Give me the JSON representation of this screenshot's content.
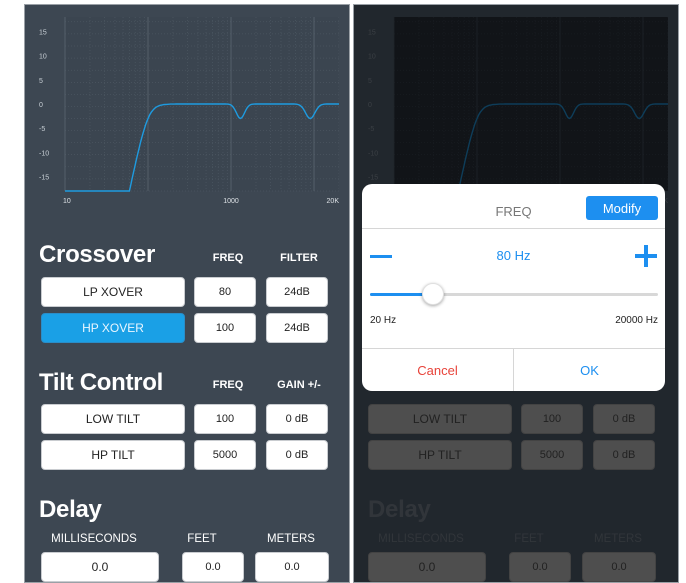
{
  "graph": {
    "y_ticks": [
      "15",
      "10",
      "5",
      "0",
      "-5",
      "-10",
      "-15"
    ],
    "x_ticks": [
      "10",
      "1000",
      "20K"
    ],
    "curve_color": "#1e9be0"
  },
  "crossover": {
    "title": "Crossover",
    "freq_header": "FREQ",
    "filter_header": "FILTER",
    "rows": [
      {
        "label": "LP XOVER",
        "freq": "80",
        "filter": "24dB",
        "active": false
      },
      {
        "label": "HP XOVER",
        "freq": "100",
        "filter": "24dB",
        "active": true
      }
    ]
  },
  "tilt": {
    "title": "Tilt Control",
    "freq_header": "FREQ",
    "gain_header": "GAIN +/-",
    "rows": [
      {
        "label": "LOW TILT",
        "freq": "100",
        "gain": "0 dB"
      },
      {
        "label": "HP TILT",
        "freq": "5000",
        "gain": "0 dB"
      }
    ]
  },
  "delay": {
    "title": "Delay",
    "ms_header": "MILLISECONDS",
    "feet_header": "FEET",
    "meters_header": "METERS",
    "ms_value": "0.0",
    "feet_value": "0.0",
    "meters_value": "0.0"
  },
  "dialog": {
    "title": "FREQ",
    "modify_label": "Modify",
    "value_label": "80 Hz",
    "min_label": "20 Hz",
    "max_label": "20000 Hz",
    "slider_fraction": 0.22,
    "cancel_label": "Cancel",
    "ok_label": "OK"
  },
  "colors": {
    "accent": "#1d8ff0",
    "active_button": "#1aa0e6",
    "cancel": "#e8433a",
    "panel_bg": "#3d4752"
  }
}
